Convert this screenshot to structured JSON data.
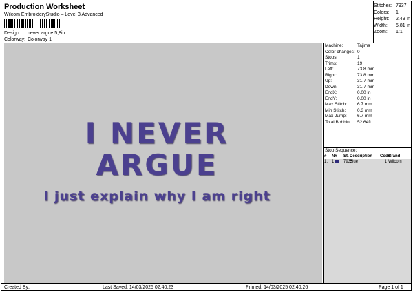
{
  "header": {
    "title": "Production Worksheet",
    "subtitle": "Wilcom EmbroideryStudio – Level 3 Advanced",
    "design_label": "Design:",
    "design_value": "never argue 5,8in",
    "colorway_label": "Colorway:",
    "colorway_value": "Colorway 1"
  },
  "stats": [
    {
      "label": "Stitches:",
      "value": "7937"
    },
    {
      "label": "Colors:",
      "value": "1"
    },
    {
      "label": "Height:",
      "value": "2.49 in"
    },
    {
      "label": "Width:",
      "value": "5.81 in"
    },
    {
      "label": "Zoom:",
      "value": "1:1"
    }
  ],
  "design": {
    "line1": "I NEVER",
    "line2": "ARGUE",
    "line3": "I just explain why I am right",
    "thread_color": "#4b3f8f",
    "background": "#c8c8c8"
  },
  "machine": [
    {
      "label": "Machine:",
      "value": "Tajima"
    },
    {
      "label": "Color changes:",
      "value": "0"
    },
    {
      "label": "Stops:",
      "value": "1"
    },
    {
      "label": "Trims:",
      "value": "19"
    },
    {
      "label": "Left:",
      "value": "73.8 mm"
    },
    {
      "label": "Right:",
      "value": "73.8 mm"
    },
    {
      "label": "Up:",
      "value": "31.7 mm"
    },
    {
      "label": "Down:",
      "value": "31.7 mm"
    },
    {
      "label": "EndX:",
      "value": "0.00 in"
    },
    {
      "label": "EndY:",
      "value": "0.00 in"
    },
    {
      "label": "Max Stitch:",
      "value": "6.7 mm"
    },
    {
      "label": "Min Stitch:",
      "value": "0.3 mm"
    },
    {
      "label": "Max Jump:",
      "value": "6.7 mm"
    },
    {
      "label": "Total Bobbin:",
      "value": "52.64ft"
    }
  ],
  "stop_sequence": {
    "title": "Stop Sequence:",
    "headers": [
      "#",
      "N#",
      "St.",
      "Description",
      "Code",
      "Brand"
    ],
    "rows": [
      {
        "num": "1.",
        "n": "1",
        "st": "7935",
        "description": "Blue",
        "code": "1",
        "brand": "Wilcom",
        "color": "#2d2a7a"
      }
    ]
  },
  "footer": {
    "created_by": "Created By:",
    "last_saved": "Last Saved: 14/03/2025 02.40.23",
    "printed": "Printed: 14/03/2025 02.40.26",
    "page": "Page 1 of 1"
  }
}
